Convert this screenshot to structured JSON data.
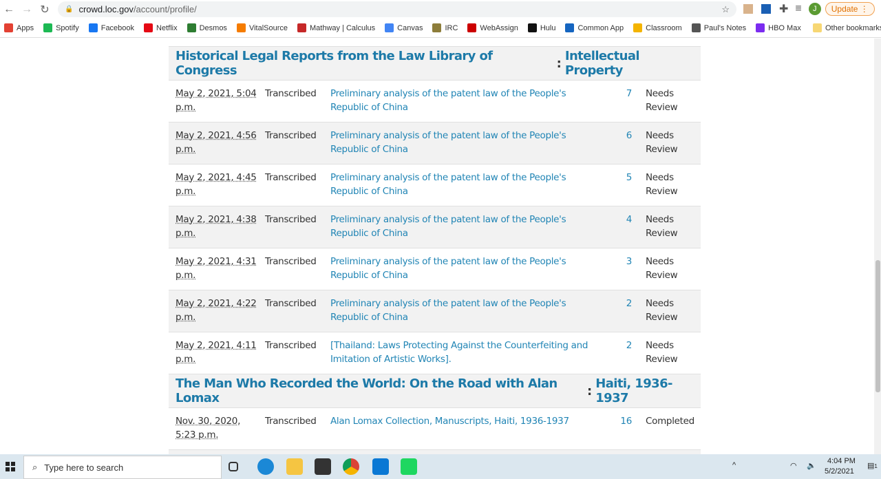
{
  "browser": {
    "url_host": "crowd.loc.gov",
    "url_path": "/account/profile/",
    "update_label": "Update",
    "avatar_letter": "J",
    "bookmarks": [
      {
        "label": "Apps",
        "color": "#e34133"
      },
      {
        "label": "Spotify",
        "color": "#1db954"
      },
      {
        "label": "Facebook",
        "color": "#1877f2"
      },
      {
        "label": "Netflix",
        "color": "#e50914"
      },
      {
        "label": "Desmos",
        "color": "#2e7d32"
      },
      {
        "label": "VitalSource",
        "color": "#f57c00"
      },
      {
        "label": "Mathway | Calculus",
        "color": "#c62828"
      },
      {
        "label": "Canvas",
        "color": "#4285f4"
      },
      {
        "label": "IRC",
        "color": "#8d7d3a"
      },
      {
        "label": "WebAssign",
        "color": "#c00"
      },
      {
        "label": "Hulu",
        "color": "#111"
      },
      {
        "label": "Common App",
        "color": "#1565c0"
      },
      {
        "label": "Classroom",
        "color": "#f4b400"
      },
      {
        "label": "Paul's Notes",
        "color": "#555"
      },
      {
        "label": "HBO Max",
        "color": "#7b2cf0"
      }
    ],
    "other_bookmarks": "Other bookmarks"
  },
  "groups": [
    {
      "title": "Historical Legal Reports from the Law Library of Congress",
      "subtitle": "Intellectual Property",
      "rows": [
        {
          "date": "May 2, 2021, 5:04 p.m.",
          "status": "Transcribed",
          "title": "Preliminary analysis of the patent law of the People's Republic of China",
          "count": "7",
          "review": "Needs Review"
        },
        {
          "date": "May 2, 2021, 4:56 p.m.",
          "status": "Transcribed",
          "title": "Preliminary analysis of the patent law of the People's Republic of China",
          "count": "6",
          "review": "Needs Review"
        },
        {
          "date": "May 2, 2021, 4:45 p.m.",
          "status": "Transcribed",
          "title": "Preliminary analysis of the patent law of the People's Republic of China",
          "count": "5",
          "review": "Needs Review"
        },
        {
          "date": "May 2, 2021, 4:38 p.m.",
          "status": "Transcribed",
          "title": "Preliminary analysis of the patent law of the People's Republic of China",
          "count": "4",
          "review": "Needs Review"
        },
        {
          "date": "May 2, 2021, 4:31 p.m.",
          "status": "Transcribed",
          "title": "Preliminary analysis of the patent law of the People's Republic of China",
          "count": "3",
          "review": "Needs Review"
        },
        {
          "date": "May 2, 2021, 4:22 p.m.",
          "status": "Transcribed",
          "title": "Preliminary analysis of the patent law of the People's Republic of China",
          "count": "2",
          "review": "Needs Review"
        },
        {
          "date": "May 2, 2021, 4:11 p.m.",
          "status": "Transcribed",
          "title": "[Thailand: Laws Protecting Against the Counterfeiting and Imitation of Artistic Works].",
          "count": "2",
          "review": "Needs Review"
        }
      ]
    },
    {
      "title": "The Man Who Recorded the World: On the Road with Alan Lomax",
      "subtitle": "Haiti, 1936-1937",
      "rows": [
        {
          "date": "Nov. 30, 2020, 5:23 p.m.",
          "status": "Transcribed",
          "title": "Alan Lomax Collection, Manuscripts, Haiti, 1936-1937",
          "count": "16",
          "review": "Completed"
        }
      ]
    }
  ],
  "taskbar": {
    "search_placeholder": "Type here to search",
    "time": "4:04 PM",
    "date": "5/2/2021",
    "notifications": "1"
  }
}
